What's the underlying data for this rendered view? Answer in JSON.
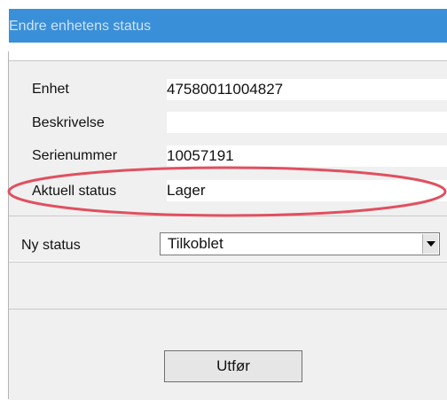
{
  "window": {
    "title": "Endre enhetens status"
  },
  "fields": [
    {
      "label": "Enhet",
      "value": "47580011004827"
    },
    {
      "label": "Beskrivelse",
      "value": ""
    },
    {
      "label": "Serienummer",
      "value": "10057191"
    },
    {
      "label": "Aktuell status",
      "value": "Lager"
    }
  ],
  "new_status": {
    "label": "Ny status",
    "selected": "Tilkoblet"
  },
  "actions": {
    "execute_label": "Utfør"
  },
  "colors": {
    "title_bar": "#3a8fd9",
    "highlight_ellipse": "#e05060",
    "panel": "#f0f0f0"
  },
  "icons": {
    "dropdown": "chevron-down-icon"
  }
}
